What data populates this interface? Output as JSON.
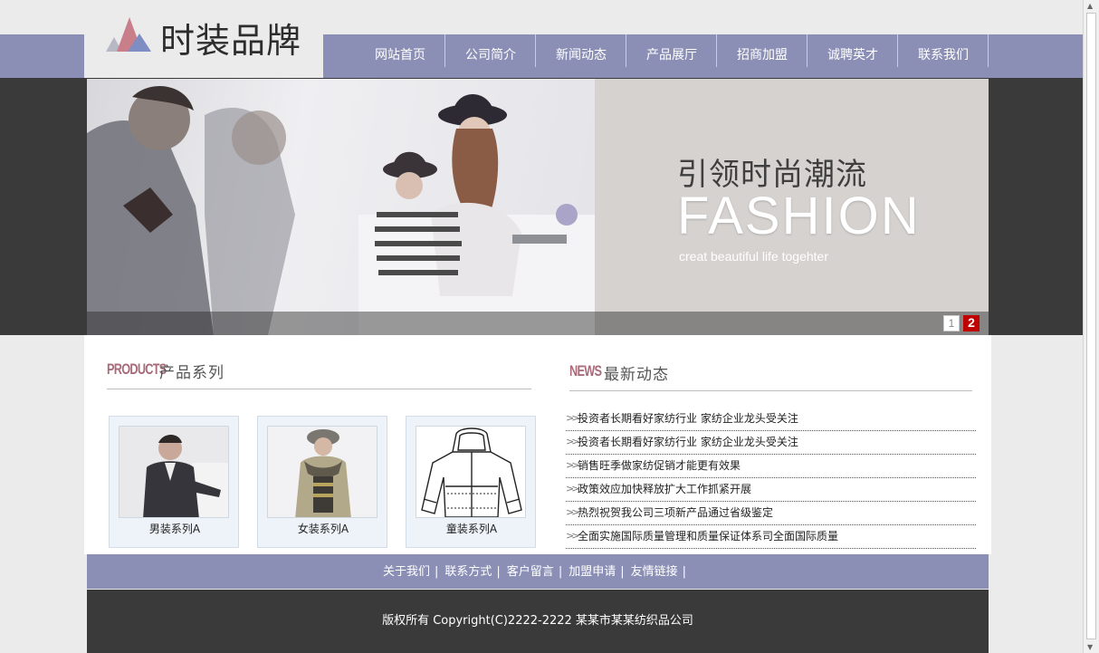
{
  "brand": {
    "name": "时装品牌",
    "logo_icon": "triangle-logo-icon",
    "colors": {
      "pink": "#c87f8a",
      "blue": "#7e8dc2"
    }
  },
  "nav": {
    "items": [
      {
        "label": "网站首页"
      },
      {
        "label": "公司简介"
      },
      {
        "label": "新闻动态"
      },
      {
        "label": "产品展厅"
      },
      {
        "label": "招商加盟"
      },
      {
        "label": "诚聘英才"
      },
      {
        "label": "联系我们"
      }
    ]
  },
  "banner": {
    "slogan_cn": "引领时尚潮流",
    "slogan_en": "FASHION",
    "slogan_sub": "creat beautiful life togehter",
    "pager": [
      "1",
      "2"
    ],
    "active_page": 2
  },
  "products": {
    "title_en": "PRODUCTS",
    "title_cn": "产品系列",
    "items": [
      {
        "caption": "男装系列A",
        "image": "menswear-photo"
      },
      {
        "caption": "女装系列A",
        "image": "womenswear-photo"
      },
      {
        "caption": "童装系列A",
        "image": "kidswear-sketch"
      }
    ]
  },
  "news": {
    "title_en": "NEWS",
    "title_cn": "最新动态",
    "items": [
      "投资者长期看好家纺行业 家纺企业龙头受关注",
      "投资者长期看好家纺行业 家纺企业龙头受关注",
      "销售旺季做家纺促销才能更有效果",
      "政策效应加快释放扩大工作抓紧开展",
      "热烈祝贺我公司三项新产品通过省级鉴定",
      "全面实施国际质量管理和质量保证体系司全面国际质量"
    ]
  },
  "footer": {
    "links": [
      "关于我们",
      "联系方式",
      "客户留言",
      "加盟申请",
      "友情链接"
    ],
    "separator": "|",
    "copyright": "版权所有 Copyright(C)2222-2222 某某市某某纺织品公司"
  }
}
